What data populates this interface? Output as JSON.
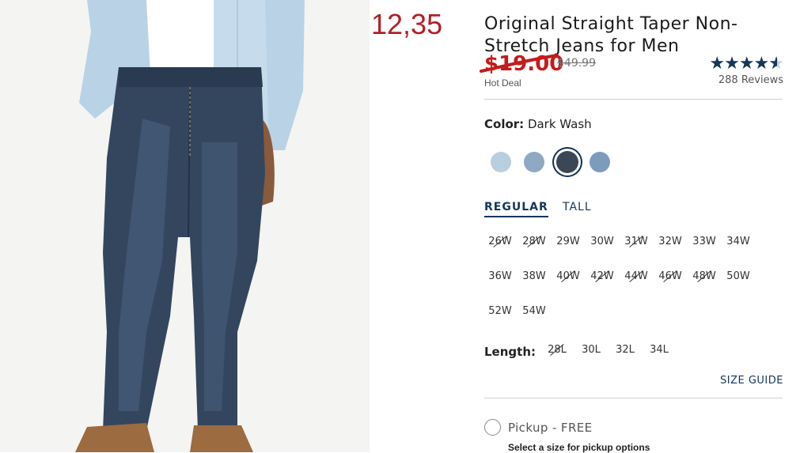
{
  "overlay_note": "12,35",
  "product": {
    "title": "Original Straight Taper Non-Stretch Jeans for Men",
    "sale_price": "$19.00",
    "original_price": "$49.99",
    "deal_label": "Hot Deal",
    "rating_value": 4.5,
    "reviews_label": "288 Reviews"
  },
  "color": {
    "label": "Color:",
    "selected_name": "Dark Wash",
    "swatches": [
      {
        "name": "light-wash",
        "color": "#b9cfe0"
      },
      {
        "name": "medium-light-wash",
        "color": "#8fa9c2"
      },
      {
        "name": "dark-wash",
        "color": "#3b4656",
        "selected": true
      },
      {
        "name": "medium-wash",
        "color": "#7d9bbd"
      }
    ]
  },
  "fit_tabs": [
    {
      "label": "REGULAR",
      "active": true
    },
    {
      "label": "TALL",
      "active": false
    }
  ],
  "waist_sizes": [
    {
      "label": "26W",
      "available": false
    },
    {
      "label": "28W",
      "available": false
    },
    {
      "label": "29W",
      "available": true
    },
    {
      "label": "30W",
      "available": true
    },
    {
      "label": "31W",
      "available": false
    },
    {
      "label": "32W",
      "available": true
    },
    {
      "label": "33W",
      "available": true
    },
    {
      "label": "34W",
      "available": true
    },
    {
      "label": "36W",
      "available": true
    },
    {
      "label": "38W",
      "available": true
    },
    {
      "label": "40W",
      "available": false
    },
    {
      "label": "42W",
      "available": false
    },
    {
      "label": "44W",
      "available": false
    },
    {
      "label": "46W",
      "available": false
    },
    {
      "label": "48W",
      "available": false
    },
    {
      "label": "50W",
      "available": true
    },
    {
      "label": "52W",
      "available": true
    },
    {
      "label": "54W",
      "available": true
    }
  ],
  "length": {
    "label": "Length:",
    "options": [
      {
        "label": "28L",
        "available": false
      },
      {
        "label": "30L",
        "available": true
      },
      {
        "label": "32L",
        "available": true
      },
      {
        "label": "34L",
        "available": true
      }
    ]
  },
  "size_guide_label": "SIZE GUIDE",
  "pickup": {
    "label": "Pickup - FREE",
    "note": "Select a size for pickup options"
  }
}
